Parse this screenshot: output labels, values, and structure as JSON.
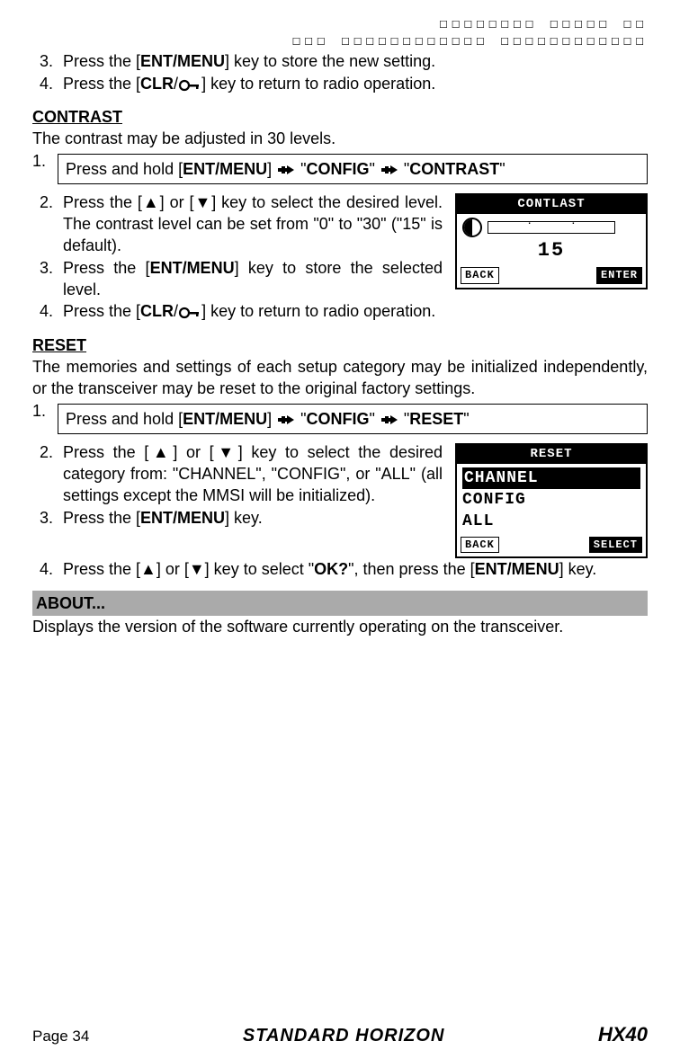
{
  "stamp": {
    "line1": "☐☐☐☐☐☐☐☐ ☐☐☐☐☐ ☐☐",
    "line2": "☐☐☐ ☐☐☐☐☐☐☐☐☐☐☐☐ ☐☐☐☐☐☐☐☐☐☐☐☐"
  },
  "intro": {
    "step3_a": "Press the [",
    "step3_b": "ENT/MENU",
    "step3_c": "] key to store the new setting.",
    "step4_a": "Press the [",
    "step4_b": "CLR",
    "step4_c": "/",
    "step4_d": "] key to return to radio operation."
  },
  "contrast": {
    "heading": "CONTRAST",
    "desc": "The contrast may be adjusted in 30 levels.",
    "nav_a": "Press and hold [",
    "nav_b": "ENT/MENU",
    "nav_c": "] ",
    "nav_d": " \"",
    "nav_e": "CONFIG",
    "nav_f": "\" ",
    "nav_g": " \"",
    "nav_h": "CONTRAST",
    "nav_i": "\"",
    "step2": "Press the [▲] or [▼] key to select the desired level. The contrast level can be set from \"0\" to \"30\" (\"15\" is default).",
    "step3_a": "Press the [",
    "step3_b": "ENT/MENU",
    "step3_c": "] key to store the selected level.",
    "step4_a": "Press the [",
    "step4_b": "CLR",
    "step4_c": "/",
    "step4_d": "] key to return to radio operation.",
    "lcd": {
      "title": "CONTLAST",
      "value": "15",
      "back": "BACK",
      "enter": "ENTER",
      "tick1": ".",
      "tick2": "."
    }
  },
  "reset": {
    "heading": "RESET",
    "desc": "The memories and settings of each setup category may be initialized independently, or the transceiver may be reset to the original factory settings.",
    "nav_a": "Press and hold [",
    "nav_b": "ENT/MENU",
    "nav_c": "] ",
    "nav_d": " \"",
    "nav_e": "CONFIG",
    "nav_f": "\" ",
    "nav_g": " \"",
    "nav_h": "RESET",
    "nav_i": "\"",
    "step2": "Press the [▲] or [▼] key to select the desired category from: \"CHANNEL\", \"CONFIG\", or \"ALL\" (all settings except the MMSI will be initialized).",
    "step3_a": "Press the [",
    "step3_b": "ENT/MENU",
    "step3_c": "] key.",
    "step4_a": "Press the [▲] or [▼] key to select \"",
    "step4_b": "OK?",
    "step4_c": "\", then press the [",
    "step4_d": "ENT/MENU",
    "step4_e": "] key.",
    "lcd": {
      "title": "RESET",
      "opt1": "CHANNEL",
      "opt2": "CONFIG",
      "opt3": "ALL",
      "back": "BACK",
      "select": "SELECT"
    }
  },
  "about": {
    "heading": "ABOUT...",
    "desc": "Displays the version of the software currently operating on the transceiver."
  },
  "footer": {
    "page": "Page 34",
    "brand": "STANDARD HORIZON",
    "model": "HX40"
  }
}
